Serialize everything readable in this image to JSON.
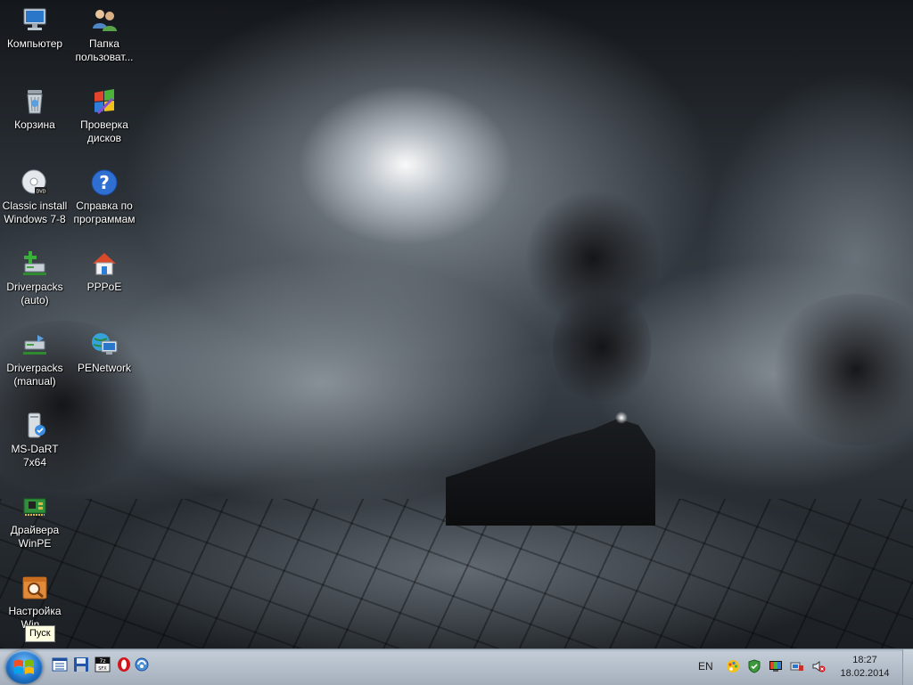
{
  "desktop": {
    "icons": [
      {
        "label": "Компьютер",
        "icon": "computer-icon"
      },
      {
        "label": "Папка\nпользоват...",
        "icon": "user-folder-icon"
      },
      {
        "label": "Корзина",
        "icon": "recycle-bin-icon"
      },
      {
        "label": "Проверка\nдисков",
        "icon": "disk-check-icon"
      },
      {
        "label": "Classic install\nWindows 7-8",
        "icon": "dvd-icon"
      },
      {
        "label": "Справка по\nпрограммам",
        "icon": "help-icon"
      },
      {
        "label": "Driverpacks\n(auto)",
        "icon": "driverpack-auto-icon"
      },
      {
        "label": "PPPoE",
        "icon": "network-home-icon"
      },
      {
        "label": "Driverpacks\n(manual)",
        "icon": "driverpack-manual-icon"
      },
      {
        "label": "PENetwork",
        "icon": "globe-monitor-icon"
      },
      {
        "label": "MS-DaRT\n7x64",
        "icon": "dart-tower-icon"
      },
      {
        "label": "Драйвера\nWinPE",
        "icon": "circuit-board-icon"
      },
      {
        "label": "Настройка\nWin...",
        "icon": "settings-search-icon"
      }
    ]
  },
  "tooltip": {
    "text": "Пуск"
  },
  "taskbar": {
    "start_icon": "windows-logo-icon",
    "quick_launch": [
      {
        "icon": "window-list-icon"
      },
      {
        "icon": "floppy-save-icon"
      },
      {
        "icon": "7zip-sfx-icon"
      },
      {
        "icon": "opera-icon"
      },
      {
        "icon": "network-tool-icon"
      }
    ],
    "language": "EN",
    "tray": [
      {
        "icon": "color-palette-icon"
      },
      {
        "icon": "shield-check-icon"
      },
      {
        "icon": "color-monitor-icon"
      },
      {
        "icon": "network-adapter-icon"
      },
      {
        "icon": "speaker-muted-icon"
      }
    ],
    "clock": {
      "time": "18:27",
      "date": "18.02.2014"
    }
  }
}
